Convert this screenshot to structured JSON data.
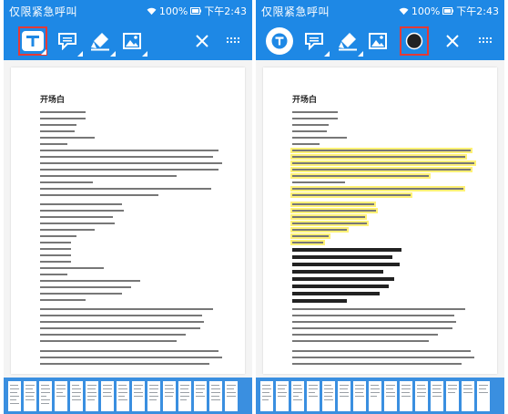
{
  "status_bar": {
    "carrier": "仅限紧急呼叫",
    "battery": "100%",
    "time": "下午2:43"
  },
  "toolbar": {
    "tools": [
      "text-tool",
      "comment-tool",
      "highlighter-tool",
      "image-tool",
      "color-tool",
      "close",
      "more"
    ],
    "icon_color": "#ffffff",
    "accent": "#1e88e5",
    "selection_outline": "#e53935"
  },
  "document": {
    "title": "开场白"
  },
  "colors": {
    "highlight_yellow": "#fff176",
    "redaction": "#222222",
    "text_dark": "#555555"
  }
}
